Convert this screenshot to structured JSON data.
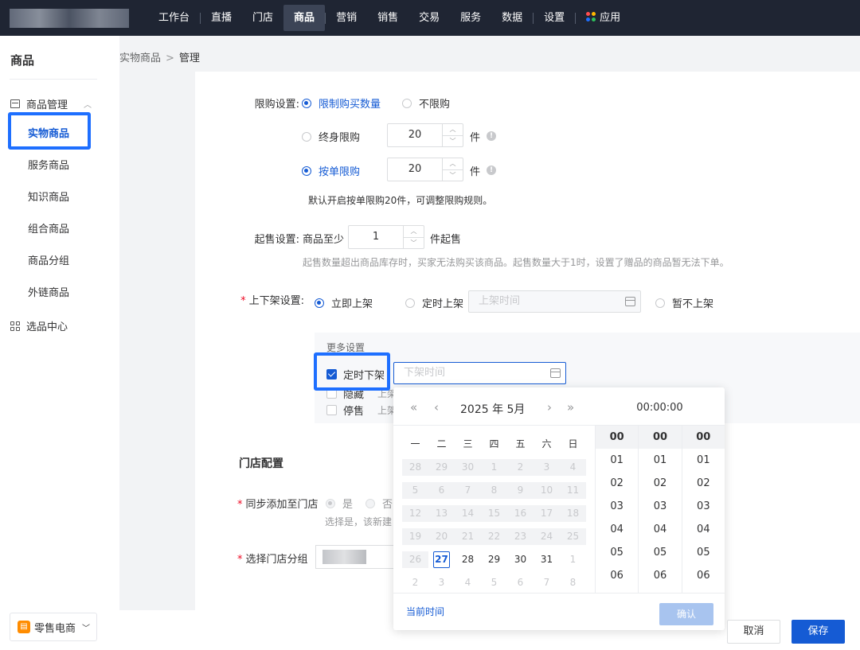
{
  "topnav": {
    "items": [
      {
        "label": "工作台"
      },
      {
        "label": "直播"
      },
      {
        "label": "门店"
      },
      {
        "label": "商品"
      },
      {
        "label": "营销"
      },
      {
        "label": "销售"
      },
      {
        "label": "交易"
      },
      {
        "label": "服务"
      },
      {
        "label": "数据"
      },
      {
        "label": "设置"
      },
      {
        "label": "应用"
      }
    ],
    "active": "商品"
  },
  "sidebar": {
    "title": "商品",
    "group": "商品管理",
    "items": [
      {
        "label": "实物商品"
      },
      {
        "label": "服务商品"
      },
      {
        "label": "知识商品"
      },
      {
        "label": "组合商品"
      },
      {
        "label": "商品分组"
      },
      {
        "label": "外链商品"
      }
    ],
    "group2": "选品中心",
    "shop_switch": "零售电商"
  },
  "breadcrumb": {
    "parent": "实物商品",
    "sep": ">",
    "current": "管理"
  },
  "purchase_limit": {
    "label": "限购设置:",
    "opt_limit": "限制购买数量",
    "opt_nolimit": "不限购",
    "lifetime_label": "终身限购",
    "lifetime_value": "20",
    "per_order_label": "按单限购",
    "per_order_value": "20",
    "unit": "件",
    "hint": "默认开启按单限购20件，可调整限购规则。"
  },
  "min_purchase": {
    "label": "起售设置:",
    "prefix": "商品至少",
    "value": "1",
    "suffix": "件起售",
    "hint": "起售数量超出商品库存时，买家无法购买该商品。起售数量大于1时，设置了赠品的商品暂无法下单。"
  },
  "shelf": {
    "label": "上下架设置:",
    "opt_now": "立即上架",
    "opt_timed": "定时上架",
    "timed_placeholder": "上架时间",
    "opt_none": "暂不上架"
  },
  "more_settings": {
    "title": "更多设置",
    "timed_off_label": "定时下架",
    "timed_off_placeholder": "下架时间",
    "hide_label": "隐藏",
    "hide_desc": "上架",
    "stop_label": "停售",
    "stop_desc": "上架"
  },
  "store": {
    "section_title": "门店配置",
    "sync_label": "同步添加至门店",
    "sync_yes": "是",
    "sync_no": "否",
    "sync_hint": "选择是，该新建",
    "group_label": "选择门店分组"
  },
  "picker": {
    "year_month": "2025 年  5月",
    "time": "00:00:00",
    "weekdays": [
      "一",
      "二",
      "三",
      "四",
      "五",
      "六",
      "日"
    ],
    "days": [
      [
        "28",
        "29",
        "30",
        "1",
        "2",
        "3",
        "4"
      ],
      [
        "5",
        "6",
        "7",
        "8",
        "9",
        "10",
        "11"
      ],
      [
        "12",
        "13",
        "14",
        "15",
        "16",
        "17",
        "18"
      ],
      [
        "19",
        "20",
        "21",
        "22",
        "23",
        "24",
        "25"
      ],
      [
        "26",
        "27",
        "28",
        "29",
        "30",
        "31",
        "1"
      ],
      [
        "2",
        "3",
        "4",
        "5",
        "6",
        "7",
        "8"
      ]
    ],
    "today": "27",
    "hours": [
      "00",
      "01",
      "02",
      "03",
      "04",
      "05",
      "06"
    ],
    "minutes": [
      "00",
      "01",
      "02",
      "03",
      "04",
      "05",
      "06"
    ],
    "seconds": [
      "00",
      "01",
      "02",
      "03",
      "04",
      "05",
      "06"
    ],
    "now_link": "当前时间",
    "confirm": "确认"
  },
  "footer": {
    "cancel": "取消",
    "save": "保存"
  },
  "colors": {
    "primary": "#155bd4",
    "highlight": "#1e6fff",
    "topbar": "#1f2533"
  }
}
